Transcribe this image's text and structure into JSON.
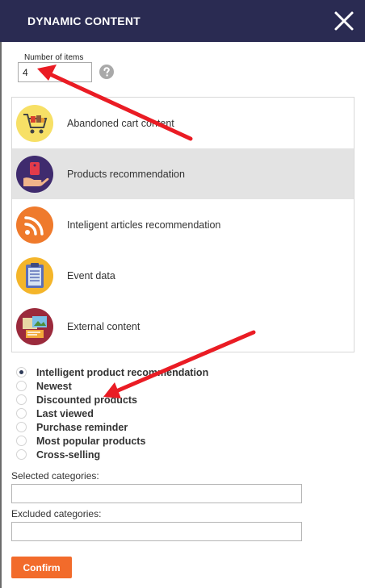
{
  "header": {
    "title": "DYNAMIC CONTENT"
  },
  "number_of_items": {
    "label": "Number of items",
    "value": "4"
  },
  "content_types": [
    {
      "label": "Abandoned cart content",
      "icon": "shopping-cart-icon",
      "color": "#f7e066",
      "selected": false
    },
    {
      "label": "Products recommendation",
      "icon": "product-tag-hand-icon",
      "color": "#3f2b6e",
      "selected": true
    },
    {
      "label": "Inteligent articles recommendation",
      "icon": "rss-icon",
      "color": "#ef7a2c",
      "selected": false
    },
    {
      "label": "Event data",
      "icon": "clipboard-icon",
      "color": "#f4b52a",
      "selected": false
    },
    {
      "label": "External content",
      "icon": "external-content-icon",
      "color": "#9b2a3c",
      "selected": false
    }
  ],
  "recommendation_modes": [
    {
      "label": "Intelligent product recommendation",
      "checked": true
    },
    {
      "label": "Newest",
      "checked": false
    },
    {
      "label": "Discounted products",
      "checked": false
    },
    {
      "label": "Last viewed",
      "checked": false
    },
    {
      "label": "Purchase reminder",
      "checked": false
    },
    {
      "label": "Most popular products",
      "checked": false
    },
    {
      "label": "Cross-selling",
      "checked": false
    }
  ],
  "fields": {
    "selected_categories_label": "Selected categories:",
    "selected_categories_value": "",
    "excluded_categories_label": "Excluded categories:",
    "excluded_categories_value": ""
  },
  "confirm_label": "Confirm",
  "colors": {
    "header_bg": "#2a2b52",
    "accent": "#f26b2b",
    "annotation_arrow": "#ea1c24",
    "selected_row_bg": "#e3e3e3"
  }
}
